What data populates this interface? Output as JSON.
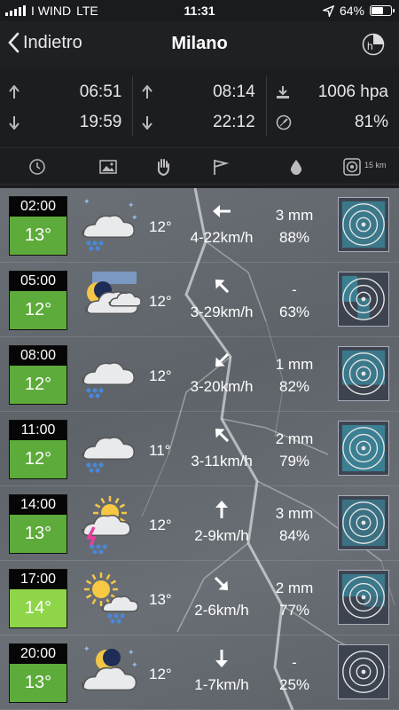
{
  "status_bar": {
    "carrier": "I WIND",
    "network": "LTE",
    "time": "11:31",
    "battery": "64%",
    "battery_level": 0.64
  },
  "nav": {
    "back_label": "Indietro",
    "title": "Milano",
    "menu_icon": "h-clock-icon"
  },
  "info": {
    "sunrise": "06:51",
    "sunset": "19:59",
    "moonrise": "08:14",
    "moonset": "22:12",
    "pressure": "1006 hpa",
    "humidity": "81%"
  },
  "header": {
    "icons": [
      "clock-icon",
      "image-icon",
      "hand-icon",
      "flag-icon",
      "drop-icon",
      "radar-icon"
    ],
    "radar_range": "15 km"
  },
  "forecast": [
    {
      "time": "02:00",
      "temp": "13°",
      "icon": "cloud-rain-night",
      "temp2": "12°",
      "wind": "4-22km/h",
      "wind_dir": "W",
      "rain": "3 mm",
      "humidity": "88%"
    },
    {
      "time": "05:00",
      "temp": "12°",
      "icon": "moon-cloud-fog",
      "temp2": "12°",
      "wind": "3-29km/h",
      "wind_dir": "NW",
      "rain": "-",
      "humidity": "63%"
    },
    {
      "time": "08:00",
      "temp": "12°",
      "icon": "cloud-rain",
      "temp2": "12°",
      "wind": "3-20km/h",
      "wind_dir": "SW",
      "rain": "1 mm",
      "humidity": "82%"
    },
    {
      "time": "11:00",
      "temp": "12°",
      "icon": "cloud-rain",
      "temp2": "11°",
      "wind": "3-11km/h",
      "wind_dir": "NW",
      "rain": "2 mm",
      "humidity": "79%"
    },
    {
      "time": "14:00",
      "temp": "13°",
      "icon": "sun-cloud-storm",
      "temp2": "12°",
      "wind": "2-9km/h",
      "wind_dir": "N",
      "rain": "3 mm",
      "humidity": "84%"
    },
    {
      "time": "17:00",
      "temp": "14°",
      "icon": "sun-cloud-rain",
      "temp2": "13°",
      "wind": "2-6km/h",
      "wind_dir": "SE",
      "rain": "2 mm",
      "humidity": "77%"
    },
    {
      "time": "20:00",
      "temp": "13°",
      "icon": "moon-cloud",
      "temp2": "12°",
      "wind": "1-7km/h",
      "wind_dir": "S",
      "rain": "-",
      "humidity": "25%"
    }
  ],
  "colors": {
    "temp_green": "#5dab3a",
    "temp_light_green": "#8ed54a",
    "background": "#1c1d20"
  }
}
